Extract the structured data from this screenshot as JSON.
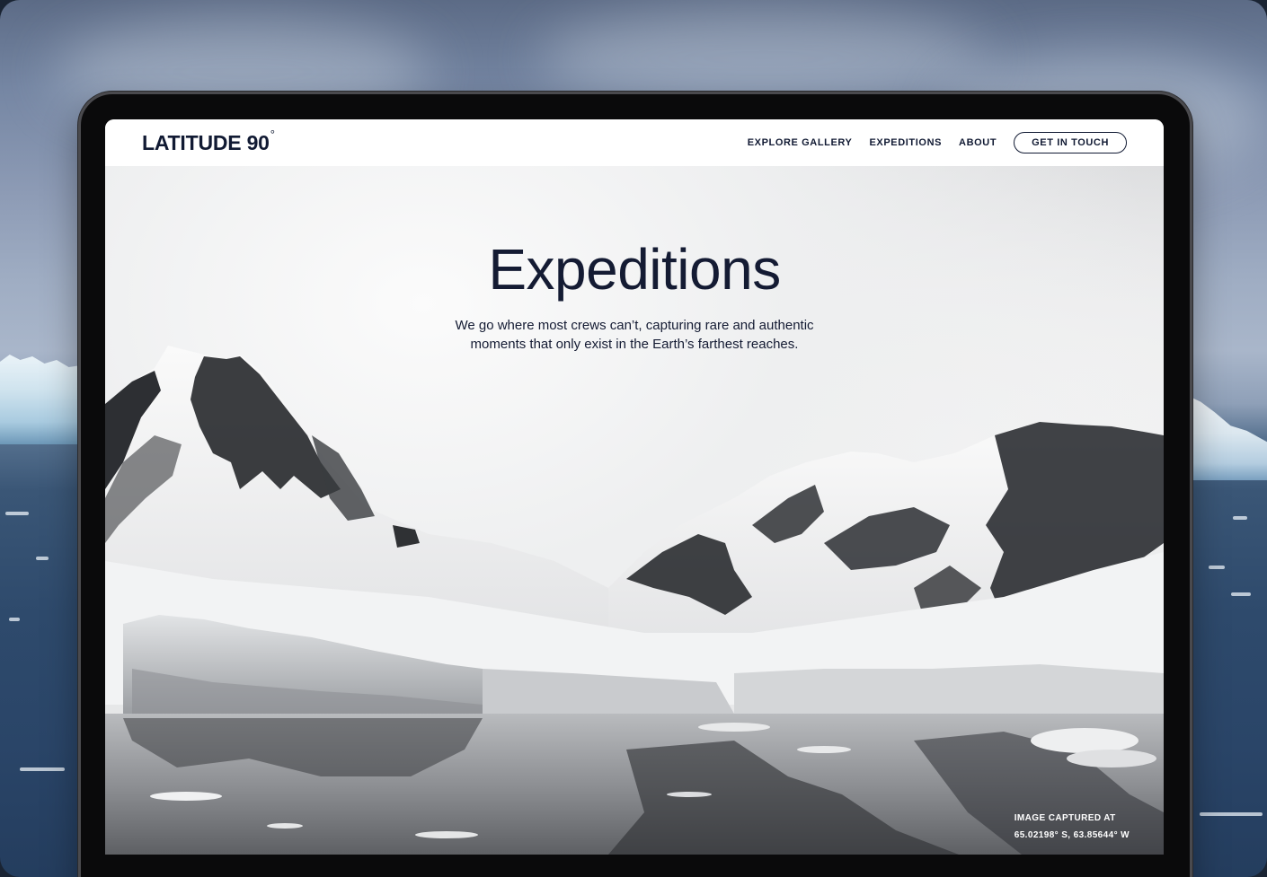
{
  "brand": {
    "name": "LATITUDE 90",
    "degree_symbol": "°"
  },
  "nav": {
    "links": [
      {
        "label": "EXPLORE GALLERY"
      },
      {
        "label": "EXPEDITIONS"
      },
      {
        "label": "ABOUT"
      }
    ],
    "cta_label": "GET IN TOUCH"
  },
  "hero": {
    "title": "Expeditions",
    "subtitle": "We go where most crews can’t, capturing rare and authentic moments that only exist in the Earth’s farthest reaches."
  },
  "caption": {
    "line1": "IMAGE CAPTURED AT",
    "line2": "65.02198° S, 63.85644° W"
  },
  "colors": {
    "ink": "#141b33",
    "navbar_bg": "#ffffff",
    "frame": "#0a0a0b"
  }
}
